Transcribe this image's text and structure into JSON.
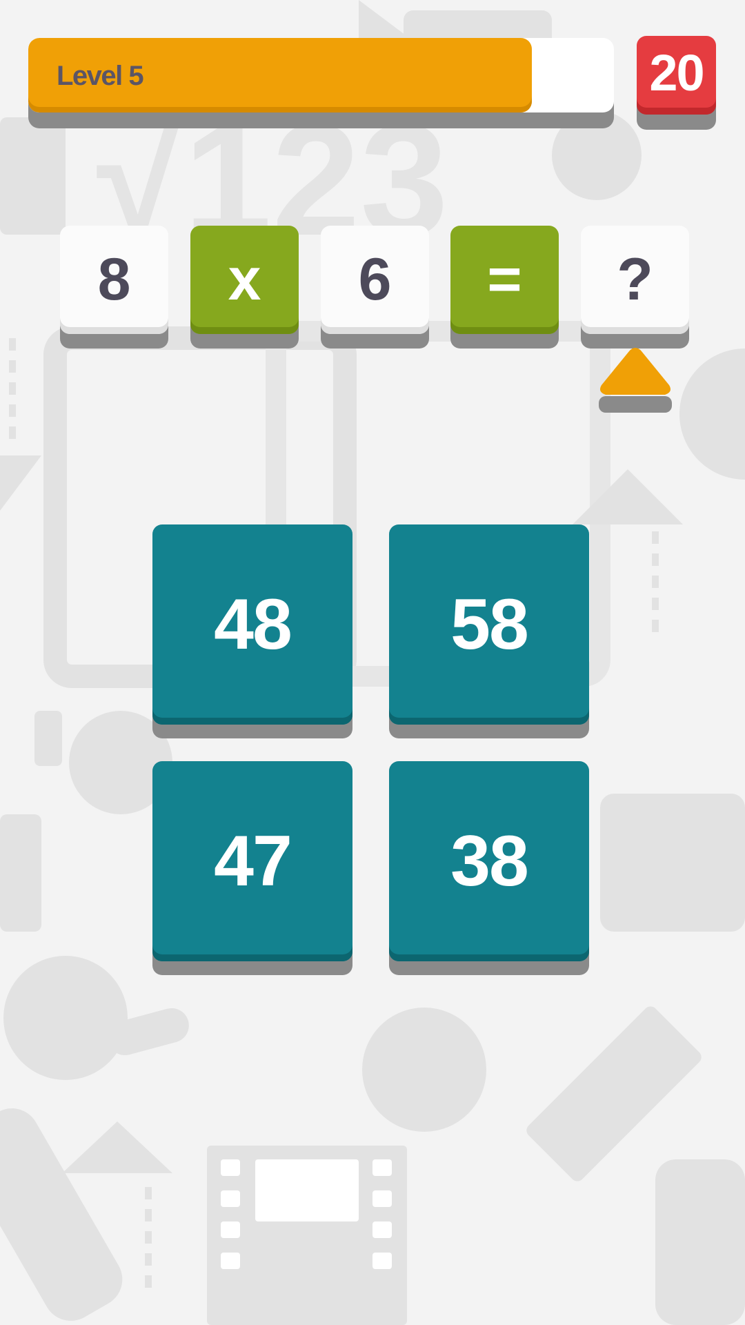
{
  "level": {
    "label": "Level 5",
    "progress": 0.86
  },
  "timer": {
    "value": "20"
  },
  "equation": [
    {
      "text": "8",
      "style": "white"
    },
    {
      "text": "x",
      "style": "green"
    },
    {
      "text": "6",
      "style": "white"
    },
    {
      "text": "=",
      "style": "green"
    },
    {
      "text": "?",
      "style": "white"
    }
  ],
  "answers": [
    "48",
    "58",
    "47",
    "38"
  ],
  "colors": {
    "progress": "#f0a006",
    "timer": "#e53c40",
    "operator_tile": "#86a81e",
    "answer_tile": "#13828f",
    "pointer": "#f0a006"
  },
  "icons": [
    "pointer-up-icon"
  ]
}
